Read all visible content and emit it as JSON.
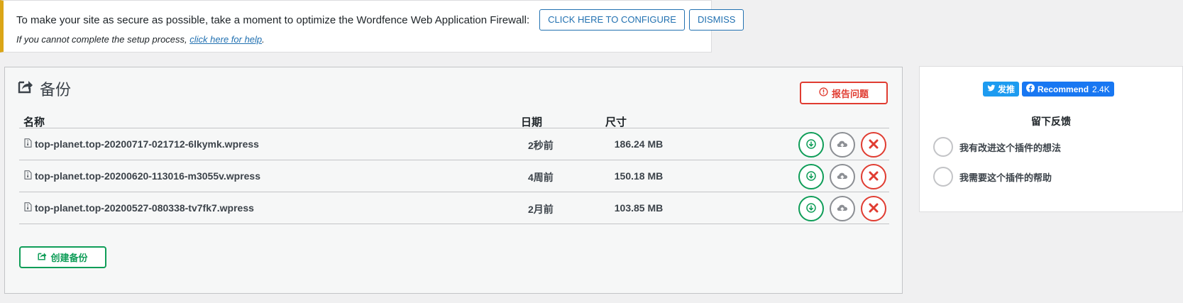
{
  "notice": {
    "message": "To make your site as secure as possible, take a moment to optimize the Wordfence Web Application Firewall:",
    "configure_label": "CLICK HERE TO CONFIGURE",
    "dismiss_label": "DISMISS",
    "help_prefix": "If you cannot complete the setup process, ",
    "help_link": "click here for help",
    "help_suffix": "."
  },
  "backups": {
    "title": "备份",
    "report_label": "报告问题",
    "columns": {
      "name": "名称",
      "date": "日期",
      "size": "尺寸"
    },
    "rows": [
      {
        "name": "top-planet.top-20200717-021712-6lkymk.wpress",
        "date": "2秒前",
        "size": "186.24 MB"
      },
      {
        "name": "top-planet.top-20200620-113016-m3055v.wpress",
        "date": "4周前",
        "size": "150.18 MB"
      },
      {
        "name": "top-planet.top-20200527-080338-tv7fk7.wpress",
        "date": "2月前",
        "size": "103.85 MB"
      }
    ],
    "create_label": "创建备份"
  },
  "sidebar": {
    "tweet_label": "发推",
    "recommend_label": "Recommend",
    "recommend_count": "2.4K",
    "feedback_title": "留下反馈",
    "options": [
      "我有改进这个插件的想法",
      "我需要这个插件的帮助"
    ]
  },
  "colors": {
    "accent": "#2271b1",
    "notice_border": "#dba617",
    "success": "#0f9d58",
    "danger": "#e03c31",
    "neutral": "#8c8f94",
    "twitter": "#1d9bf0",
    "facebook": "#1877f2"
  },
  "icons": {
    "title": "share-export-icon",
    "report": "exclamation-circle-icon",
    "file": "file-archive-icon",
    "download": "download-arrow-icon",
    "upload": "cloud-upload-icon",
    "delete": "close-x-icon",
    "create": "share-export-icon"
  }
}
